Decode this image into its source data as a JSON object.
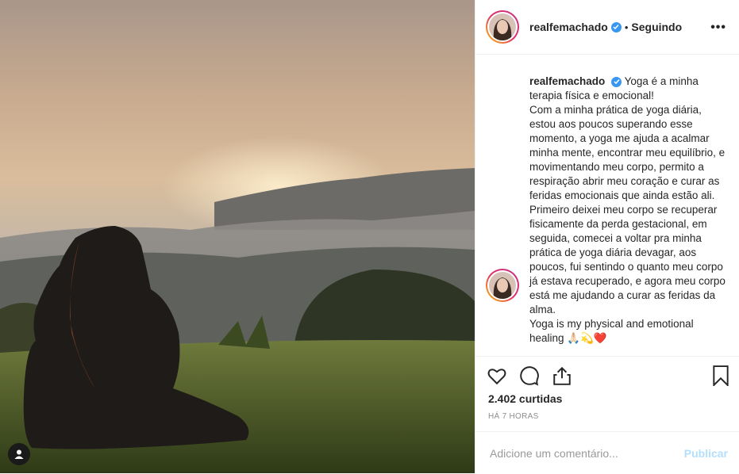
{
  "post": {
    "username": "realfemachado",
    "dot": "•",
    "following_label": "Seguindo",
    "more_label": "•••",
    "caption_username": "realfemachado",
    "caption_text": "Yoga é a minha terapia física e emocional!\nCom a minha prática de yoga diária, estou aos poucos superando esse momento, a yoga me ajuda a acalmar minha mente, encontrar meu equilíbrio, e movimentando meu corpo, permito a respiração abrir meu coração e curar as feridas emocionais que ainda estão ali. Primeiro deixei meu corpo se recuperar fisicamente da perda gestacional, em seguida, comecei a voltar pra minha prática de yoga diária devagar, aos poucos, fui sentindo o quanto meu corpo já estava recuperado, e agora meu corpo está me ajudando a curar as feridas da alma.\nYoga is my physical and emotional healing 🙏🏻💫❤️",
    "likes": "2.402 curtidas",
    "timestamp": "HÁ 7 HORAS",
    "comment_placeholder": "Adicione um comentário...",
    "publish_label": "Publicar"
  },
  "icons": {
    "verified": "verified-badge-icon",
    "like": "heart-icon",
    "comment": "comment-bubble-icon",
    "share": "share-icon",
    "save": "bookmark-icon",
    "user_tag": "user-tag-icon"
  },
  "colors": {
    "verified": "#3897f0",
    "publish_disabled": "#b2dffc",
    "border": "#efefef",
    "muted": "#8e8e8e"
  }
}
